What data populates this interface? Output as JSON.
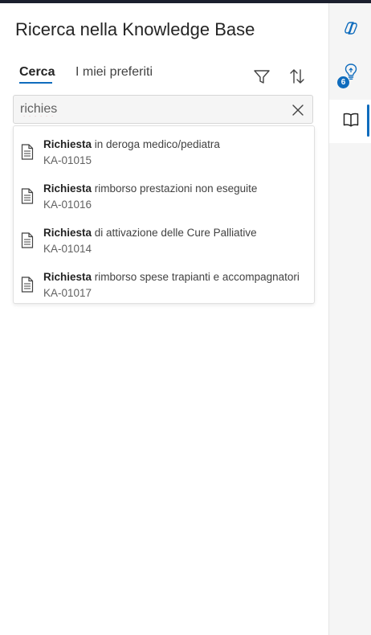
{
  "panel": {
    "title": "Ricerca nella Knowledge Base",
    "tabs": [
      {
        "label": "Cerca",
        "active": true
      },
      {
        "label": "I miei preferiti",
        "active": false
      }
    ],
    "toolbar": {
      "filter_icon": "filter-icon",
      "sort_icon": "sort-icon"
    }
  },
  "search": {
    "value": "richies",
    "clear_icon": "close-icon"
  },
  "results": [
    {
      "match": "Richiesta",
      "rest": " in deroga medico/pediatra",
      "id": "KA-01015"
    },
    {
      "match": "Richiesta",
      "rest": " rimborso prestazioni non eseguite",
      "id": "KA-01016"
    },
    {
      "match": "Richiesta",
      "rest": " di attivazione delle Cure Palliative",
      "id": "KA-01014"
    },
    {
      "match": "Richiesta",
      "rest": " rimborso spese trapianti e accompagnatori",
      "id": "KA-01017"
    }
  ],
  "rail": {
    "copilot_icon": "copilot-icon",
    "ideas_icon": "lightbulb-icon",
    "ideas_badge": "6",
    "kb_icon": "book-icon"
  },
  "colors": {
    "accent": "#0f6cbd",
    "rail_bg": "#f5f5f5",
    "spellcheck": "#d13438"
  }
}
